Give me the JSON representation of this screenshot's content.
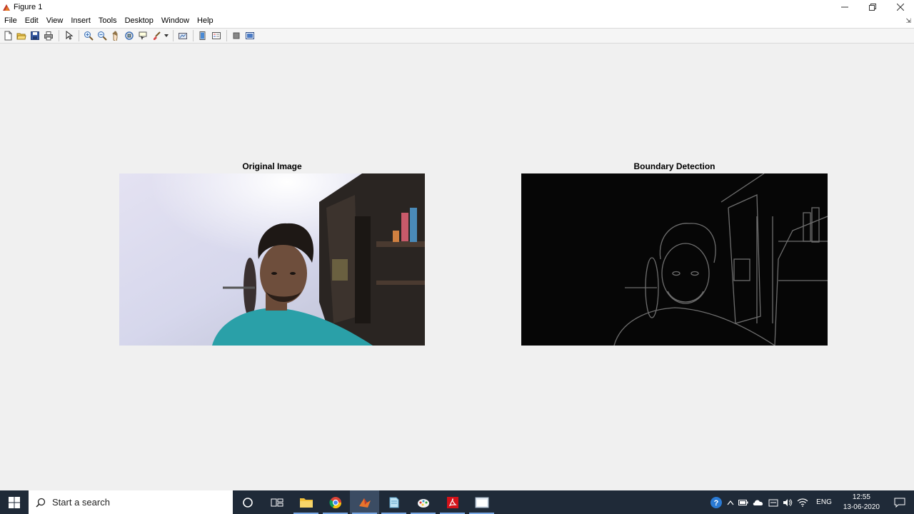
{
  "window": {
    "title": "Figure 1"
  },
  "menu": [
    "File",
    "Edit",
    "View",
    "Insert",
    "Tools",
    "Desktop",
    "Window",
    "Help"
  ],
  "toolbar": {
    "buttons": [
      "new-figure-icon",
      "open-file-icon",
      "save-icon",
      "print-icon",
      "pointer-icon",
      "zoom-in-icon",
      "zoom-out-icon",
      "pan-icon",
      "rotate-3d-icon",
      "data-cursor-icon",
      "brush-icon",
      "link-plot-icon",
      "colorbar-icon",
      "legend-icon",
      "hide-plot-tools-icon",
      "show-plot-tools-icon"
    ]
  },
  "axes": [
    {
      "title": "Original Image"
    },
    {
      "title": "Boundary Detection"
    }
  ],
  "taskbar": {
    "search_placeholder": "Start a search",
    "language": "ENG",
    "time": "12:55",
    "date": "13-06-2020",
    "apps": [
      "cortana-icon",
      "task-view-icon",
      "file-explorer-icon",
      "chrome-icon",
      "matlab-icon",
      "notepad-icon",
      "paint-icon",
      "acrobat-icon",
      "figure-window-icon"
    ]
  }
}
